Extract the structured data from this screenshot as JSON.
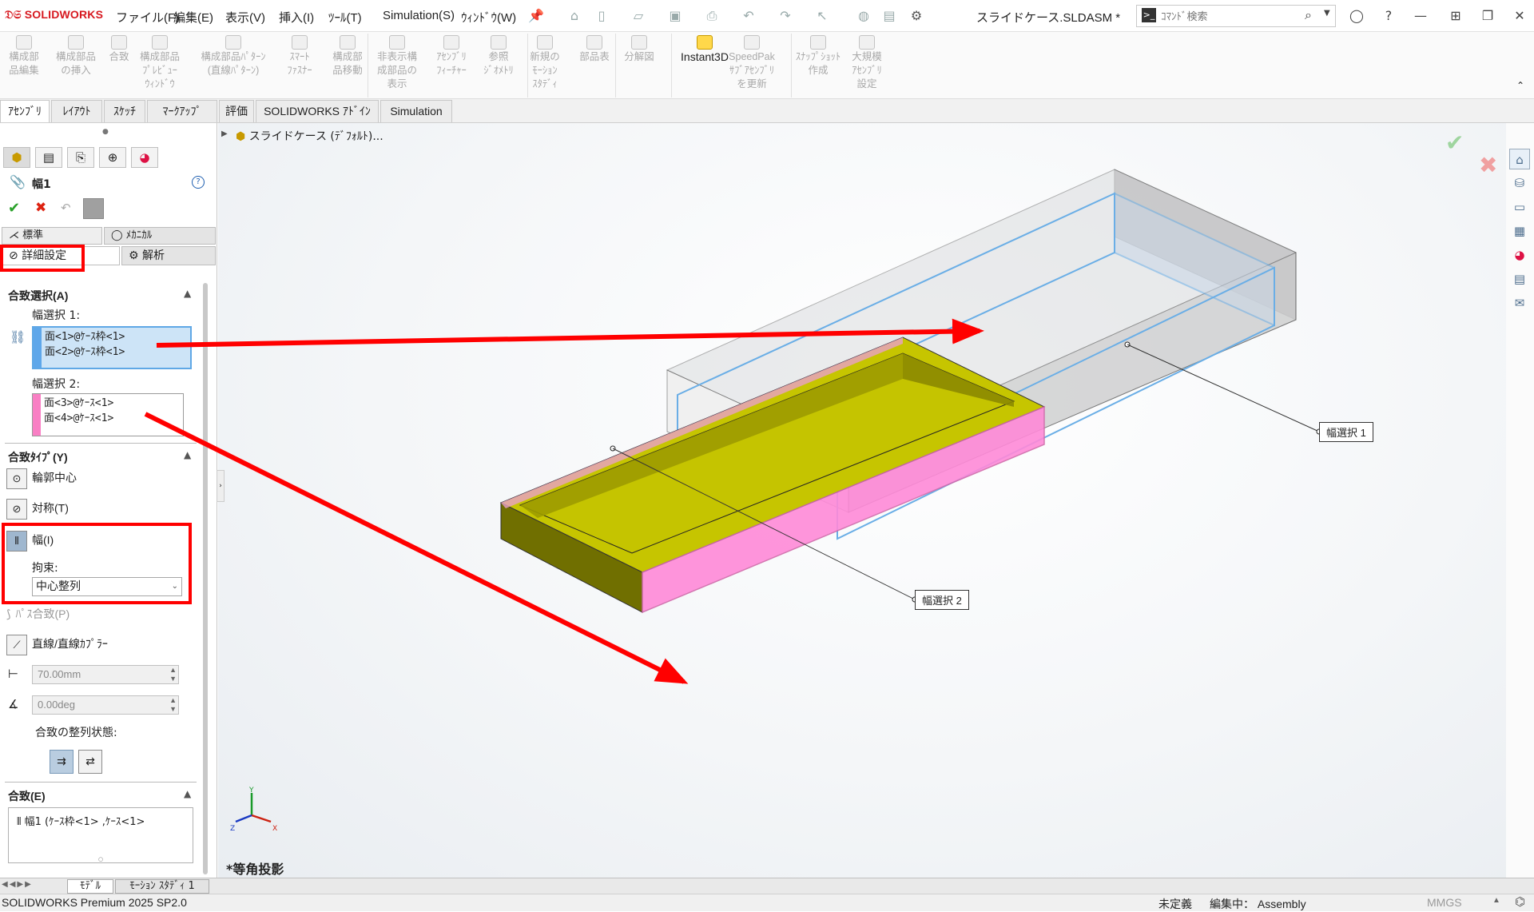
{
  "app": {
    "logo": "SOLIDWORKS",
    "doc_title": "スライドケース.SLDASM *"
  },
  "menu": [
    "ファイル(F)",
    "編集(E)",
    "表示(V)",
    "挿入(I)",
    "ﾂｰﾙ(T)",
    "Simulation(S)",
    "ｳｨﾝﾄﾞｳ(W)"
  ],
  "search": {
    "placeholder": "ｺﾏﾝﾄﾞ検索"
  },
  "ribbon": [
    {
      "label": "構成部\n品編集",
      "enabled": false
    },
    {
      "label": "構成部品\nの挿入",
      "enabled": false
    },
    {
      "label": "合致",
      "enabled": false
    },
    {
      "label": "構成部品\nﾌﾟﾚﾋﾞｭｰ\nｳｨﾝﾄﾞｳ",
      "enabled": false
    },
    {
      "label": "構成部品ﾊﾟﾀｰﾝ\n(直線ﾊﾟﾀｰﾝ)",
      "enabled": false
    },
    {
      "label": "ｽﾏｰﾄ\nﾌｧｽﾅｰ",
      "enabled": false
    },
    {
      "label": "構成部\n品移動",
      "enabled": false
    },
    {
      "label": "非表示構\n成部品の\n表示",
      "enabled": false
    },
    {
      "label": "ｱｾﾝﾌﾞﾘ\nﾌｨｰﾁｬｰ",
      "enabled": false
    },
    {
      "label": "参照\nｼﾞｵﾒﾄﾘ",
      "enabled": false
    },
    {
      "label": "新規の\nﾓｰｼｮﾝ\nｽﾀﾃﾞｨ",
      "enabled": false
    },
    {
      "label": "部品表",
      "enabled": false
    },
    {
      "label": "分解図",
      "enabled": false
    },
    {
      "label": "Instant3D",
      "enabled": true
    },
    {
      "label": "SpeedPak\nｻﾌﾞｱｾﾝﾌﾞﾘ\nを更新",
      "enabled": false
    },
    {
      "label": "ｽﾅｯﾌﾟｼｮｯﾄ\n作成",
      "enabled": false
    },
    {
      "label": "大規模\nｱｾﾝﾌﾞﾘ\n設定",
      "enabled": false
    }
  ],
  "cmd_tabs": [
    "ｱｾﾝﾌﾞﾘ",
    "ﾚｲｱｳﾄ",
    "ｽｹｯﾁ",
    "ﾏｰｸｱｯﾌﾟ",
    "評価",
    "SOLIDWORKS ｱﾄﾞｲﾝ",
    "Simulation"
  ],
  "tree": {
    "root": "スライドケース (ﾃﾞﾌｫﾙﾄ)..."
  },
  "panel": {
    "title": "幅1",
    "tab_standard": "標準",
    "tab_mechanical": "ﾒｶﾆｶﾙ",
    "tab_advanced": "詳細設定",
    "tab_analysis": "解析",
    "mate_selection": {
      "header": "合致選択(A)",
      "width_sel1_label": "幅選択 1:",
      "width_sel1": [
        "面<1>@ｹｰｽ枠<1>",
        "面<2>@ｹｰｽ枠<1>"
      ],
      "width_sel2_label": "幅選択 2:",
      "width_sel2": [
        "面<3>@ｹｰｽ<1>",
        "面<4>@ｹｰｽ<1>"
      ]
    },
    "mate_type": {
      "header": "合致ﾀｲﾌﾟ(Y)",
      "profile_center": "輪郭中心",
      "symmetric": "対称(T)",
      "width": "幅(I)",
      "constraint_label": "拘束:",
      "constraint_value": "中心整列",
      "path": "ﾊﾟｽ合致(P)",
      "linear_coupler": "直線/直線ｶﾌﾟﾗｰ",
      "distance": "70.00mm",
      "angle": "0.00deg",
      "alignment_label": "合致の整列状態:"
    },
    "mates": {
      "header": "合致(E)",
      "item": "幅1 (ｹｰｽ枠<1> ,ｹｰｽ<1>"
    }
  },
  "viewport": {
    "projection_label": "*等角投影",
    "callout1": "幅選択 1",
    "callout2": "幅選択 2",
    "axis_y": "Y",
    "axis_x": "X",
    "axis_z": "Z"
  },
  "bottom_tabs": [
    "ﾓﾃﾞﾙ",
    "ﾓｰｼｮﾝ ｽﾀﾃﾞｨ 1"
  ],
  "status": {
    "product": "SOLIDWORKS Premium 2025 SP2.0",
    "state": "未定義",
    "editing": "編集中： Assembly",
    "units": "MMGS"
  },
  "colors": {
    "highlight_red": "#ff0000",
    "selection_blue": "#6aaee6",
    "selection_pink": "#ff7fc8",
    "part_yellow": "#c8c800"
  }
}
